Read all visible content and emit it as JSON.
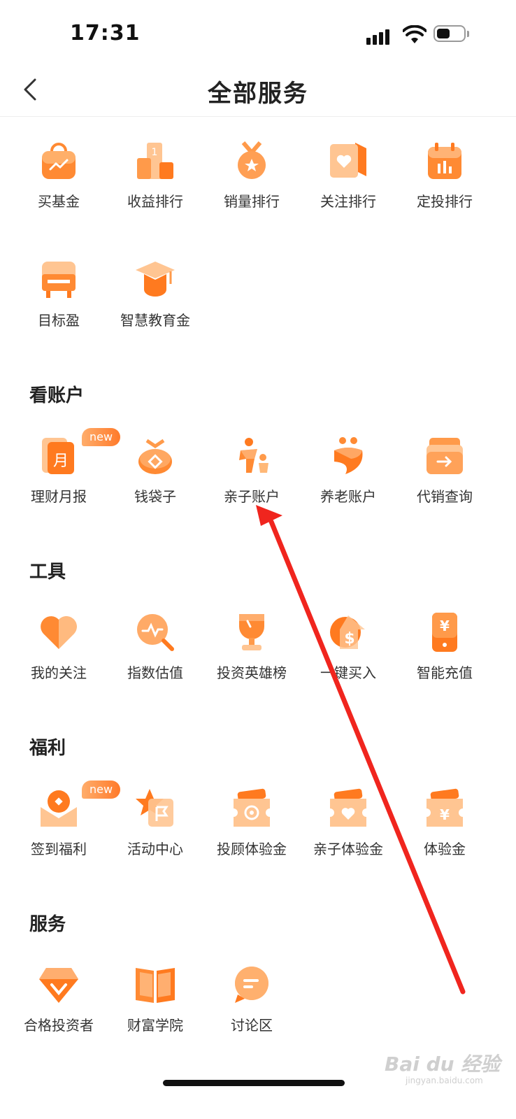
{
  "status_bar": {
    "time": "17:31"
  },
  "nav": {
    "title": "全部服务"
  },
  "sections": [
    {
      "title": "",
      "items": [
        {
          "label": "买基金",
          "icon": "shopping-bag-icon"
        },
        {
          "label": "收益排行",
          "icon": "podium-icon"
        },
        {
          "label": "销量排行",
          "icon": "medal-icon"
        },
        {
          "label": "关注排行",
          "icon": "heart-card-icon"
        },
        {
          "label": "定投排行",
          "icon": "calendar-chart-icon"
        },
        {
          "label": "目标盈",
          "icon": "train-icon"
        },
        {
          "label": "智慧教育金",
          "icon": "graduation-cap-icon"
        }
      ]
    },
    {
      "title": "看账户",
      "items": [
        {
          "label": "理财月报",
          "icon": "monthly-report-icon",
          "badge": "new"
        },
        {
          "label": "钱袋子",
          "icon": "money-bag-icon"
        },
        {
          "label": "亲子账户",
          "icon": "parent-child-icon"
        },
        {
          "label": "养老账户",
          "icon": "elder-icon"
        },
        {
          "label": "代销查询",
          "icon": "wallet-arrow-icon"
        }
      ]
    },
    {
      "title": "工具",
      "items": [
        {
          "label": "我的关注",
          "icon": "heart-icon"
        },
        {
          "label": "指数估值",
          "icon": "magnifier-chart-icon"
        },
        {
          "label": "投资英雄榜",
          "icon": "trophy-icon"
        },
        {
          "label": "一键买入",
          "icon": "dollar-upload-icon"
        },
        {
          "label": "智能充值",
          "icon": "yen-phone-icon"
        }
      ]
    },
    {
      "title": "福利",
      "items": [
        {
          "label": "签到福利",
          "icon": "checkin-envelope-icon",
          "badge": "new"
        },
        {
          "label": "活动中心",
          "icon": "star-flag-icon"
        },
        {
          "label": "投顾体验金",
          "icon": "ticket-target-icon"
        },
        {
          "label": "亲子体验金",
          "icon": "ticket-heart-icon"
        },
        {
          "label": "体验金",
          "icon": "ticket-yen-icon"
        }
      ]
    },
    {
      "title": "服务",
      "items": [
        {
          "label": "合格投资者",
          "icon": "diamond-check-icon"
        },
        {
          "label": "财富学院",
          "icon": "open-book-icon"
        },
        {
          "label": "讨论区",
          "icon": "chat-bubble-icon"
        }
      ]
    }
  ],
  "colors": {
    "accent": "#ff7a1f",
    "accent_light": "#ffc28f",
    "arrow": "#f0251e"
  },
  "watermark": {
    "brand": "Bai du 经验",
    "sub": "jingyan.baidu.com"
  }
}
